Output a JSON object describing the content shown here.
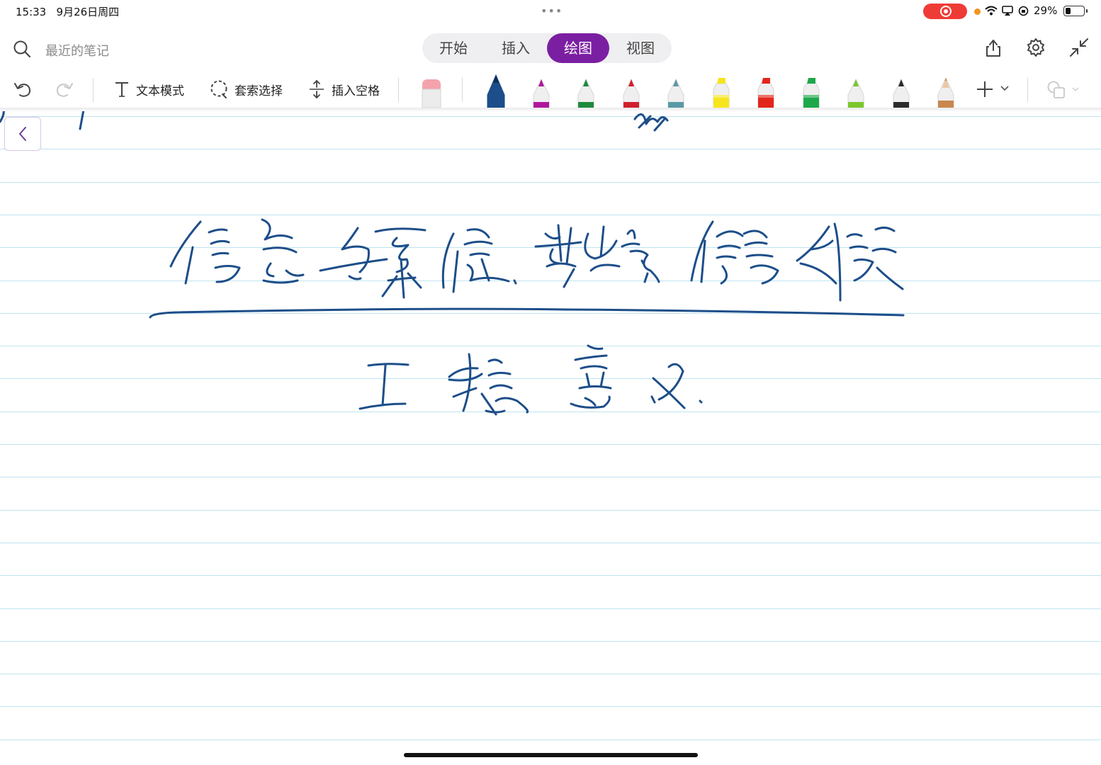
{
  "status_bar": {
    "time": "15:33",
    "date": "9月26日周四",
    "battery_pct": "29%",
    "battery_level": 0.29
  },
  "header": {
    "search_placeholder": "最近的笔记",
    "tabs": [
      {
        "label": "开始",
        "active": false
      },
      {
        "label": "插入",
        "active": false
      },
      {
        "label": "绘图",
        "active": true
      },
      {
        "label": "视图",
        "active": false
      }
    ],
    "icons": [
      "search-icon",
      "share-icon",
      "gear-icon",
      "collapse-icon"
    ]
  },
  "toolbar": {
    "text_mode": "文本模式",
    "lasso_select": "套索选择",
    "insert_space": "插入空格",
    "pens": [
      {
        "name": "eraser",
        "color": "#f4a3ad",
        "type": "eraser"
      },
      {
        "name": "pen-navy",
        "color": "#1d4e89",
        "type": "pen",
        "selected": true
      },
      {
        "name": "pen-purple",
        "color": "#b0189c",
        "type": "pen"
      },
      {
        "name": "pen-green",
        "color": "#1e8a3c",
        "type": "pen"
      },
      {
        "name": "pen-red",
        "color": "#d0202e",
        "type": "pen"
      },
      {
        "name": "pen-teal",
        "color": "#5a9aa6",
        "type": "pen"
      },
      {
        "name": "highlighter-yellow",
        "color": "#f6e51c",
        "type": "highlighter"
      },
      {
        "name": "highlighter-red",
        "color": "#e3261b",
        "type": "highlighter"
      },
      {
        "name": "highlighter-green",
        "color": "#1ea84a",
        "type": "highlighter"
      },
      {
        "name": "pen-lime",
        "color": "#7bc62d",
        "type": "pen"
      },
      {
        "name": "pen-black",
        "color": "#2b2b2b",
        "type": "pen"
      },
      {
        "name": "pencil-brown",
        "color": "#c8874f",
        "type": "pencil"
      }
    ]
  },
  "colors": {
    "accent": "#7b1fa2",
    "ink": "#1d4e89",
    "rule_line": "#bfe4f1"
  }
}
